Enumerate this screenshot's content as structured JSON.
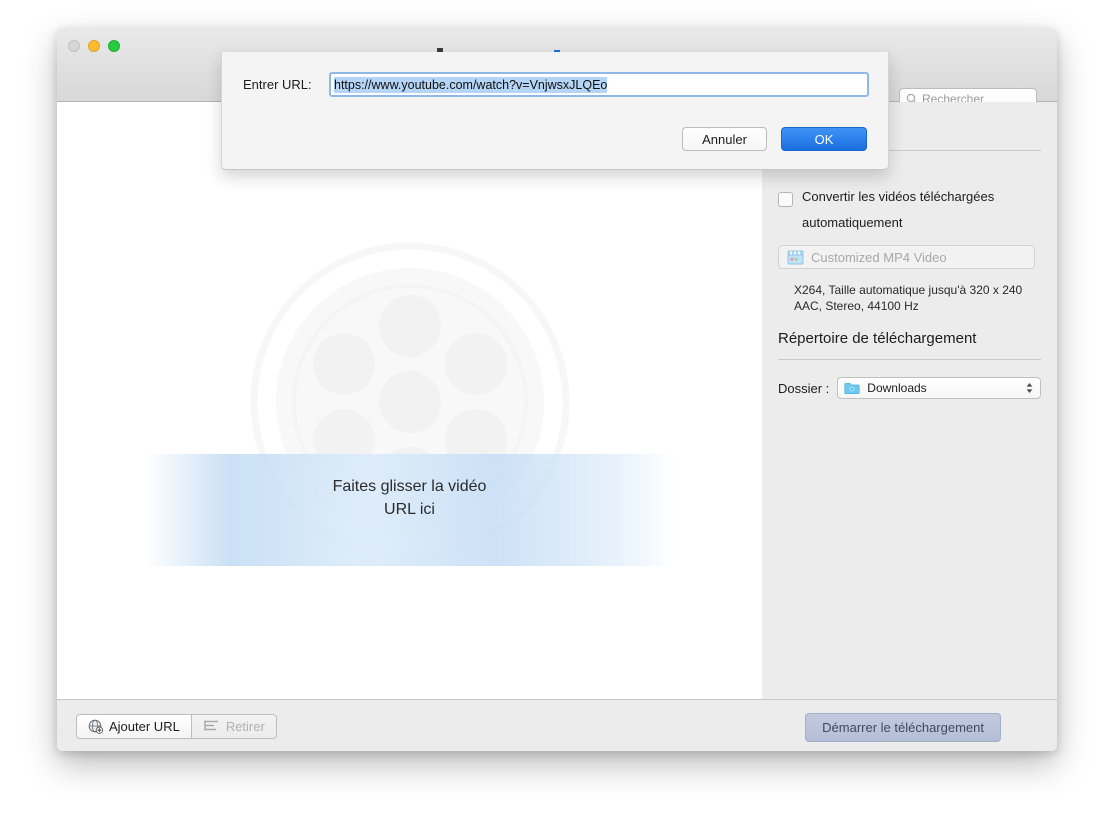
{
  "window": {
    "traffic_lights": [
      "close",
      "minimize",
      "maximize"
    ],
    "toolbar_icons": [
      "download-icon",
      "convert-icon",
      "settings-icon"
    ],
    "search": {
      "icon": "search-icon",
      "placeholder": "Rechercher",
      "value": ""
    }
  },
  "content": {
    "watermark_icon": "film-reel-icon",
    "drop_line_1": "Faites glisser la vidéo",
    "drop_line_2": "URL ici"
  },
  "sidebar": {
    "convert_checkbox": {
      "checked": false,
      "label_line_1": "Convertir les vidéos téléchargées",
      "label_line_2": "automatiquement"
    },
    "preset": {
      "icon": "video-clapper-icon",
      "label": "Customized MP4 Video",
      "enabled": false
    },
    "preset_details_line_1": "X264, Taille automatique jusqu'à 320 x 240",
    "preset_details_line_2": "AAC, Stereo, 44100 Hz",
    "section_title": "Répertoire de téléchargement",
    "folder": {
      "label": "Dossier :",
      "icon": "folder-icon",
      "value": "Downloads",
      "stepper_icon": "updown-chevron-icon"
    }
  },
  "bottombar": {
    "add_url": {
      "icon": "globe-add-icon",
      "label": "Ajouter URL",
      "enabled": true
    },
    "remove": {
      "icon": "list-remove-icon",
      "label": "Retirer",
      "enabled": false
    },
    "start_download": {
      "label": "Démarrer le téléchargement",
      "enabled": false
    }
  },
  "dialog": {
    "label": "Entrer URL:",
    "url_value": "https://www.youtube.com/watch?v=VnjwsxJLQEo",
    "url_placeholder": "",
    "cancel_label": "Annuler",
    "ok_label": "OK"
  },
  "colors": {
    "accent_blue": "#1a6fe0",
    "selection_blue": "#b4d5f5",
    "focus_ring": "#8fb8e8",
    "sidebar_bg": "#ececec",
    "disabled_button": "#b4bed6"
  }
}
